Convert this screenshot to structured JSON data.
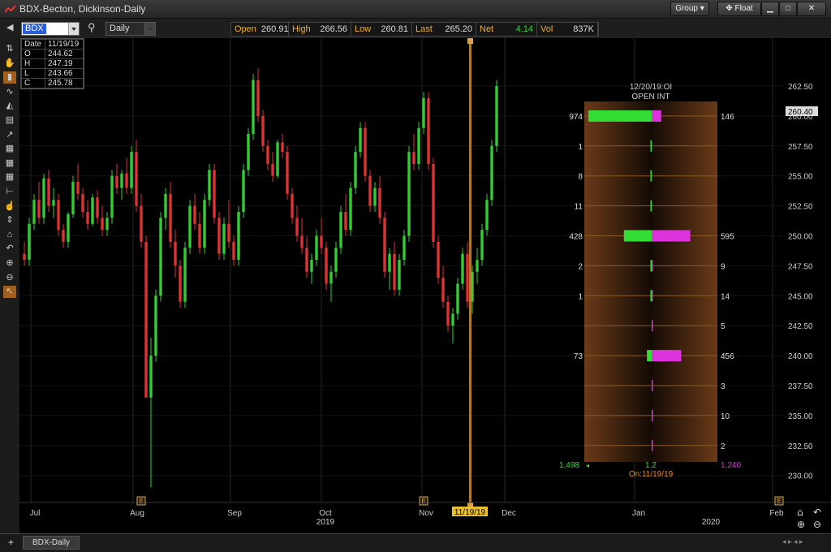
{
  "window": {
    "title": "BDX-Becton, Dickinson-Daily",
    "group_label": "Group",
    "float_label": "Float",
    "min_icon": "minimize-icon",
    "max_icon": "maximize-icon",
    "close_icon": "close-icon"
  },
  "toolbar": {
    "symbol": "BDX",
    "interval": "Daily",
    "quote": [
      {
        "label": "Open",
        "value": "260.91",
        "color": "#dddddd"
      },
      {
        "label": "High",
        "value": "266.56",
        "color": "#dddddd"
      },
      {
        "label": "Low",
        "value": "260.81",
        "color": "#dddddd"
      },
      {
        "label": "Last",
        "value": "265.20",
        "color": "#dddddd"
      },
      {
        "label": "Net",
        "value": "4.14",
        "color": "#33dd33"
      },
      {
        "label": "Vol",
        "value": "837K",
        "color": "#dddddd"
      }
    ]
  },
  "ohlc_box": {
    "rows": [
      {
        "k": "Date",
        "v": "11/19/19"
      },
      {
        "k": "O",
        "v": "244.62"
      },
      {
        "k": "H",
        "v": "247.19"
      },
      {
        "k": "L",
        "v": "243.66"
      },
      {
        "k": "C",
        "v": "245.78"
      }
    ]
  },
  "left_tools": [
    "pan-icon",
    "hand-icon",
    "candles-icon",
    "line-icon",
    "area-icon",
    "bars-icon",
    "kagi-icon",
    "grid-icon",
    "grid2-icon",
    "table-icon",
    "level-icon",
    "pointer-icon",
    "updown-icon",
    "home-icon",
    "undo-icon",
    "zoom-in-icon",
    "zoom-out-icon",
    "cursor-icon"
  ],
  "chart_data": {
    "type": "candlestick",
    "y_ticks": [
      "262.50",
      "260.00",
      "257.50",
      "255.00",
      "252.50",
      "250.00",
      "247.50",
      "245.00",
      "242.50",
      "240.00",
      "237.50",
      "235.00",
      "232.50",
      "230.00"
    ],
    "ylim": [
      229,
      265
    ],
    "last_price": "260.40",
    "x_labels": [
      {
        "text": "Jul",
        "sub": ""
      },
      {
        "text": "Aug",
        "sub": ""
      },
      {
        "text": "Sep",
        "sub": ""
      },
      {
        "text": "Oct",
        "sub": "2019"
      },
      {
        "text": "Nov",
        "sub": ""
      },
      {
        "text": "Dec",
        "sub": ""
      },
      {
        "text": "Jan",
        "sub": ""
      },
      {
        "text": "Feb",
        "sub": "2020"
      }
    ],
    "cursor_date": "11/19/19",
    "earnings_marker": "E",
    "candles": [
      [
        248.5,
        249.5,
        247.5,
        248.0
      ],
      [
        248.0,
        251.5,
        247.5,
        251.0
      ],
      [
        251.0,
        253.5,
        250.5,
        253.0
      ],
      [
        253.0,
        254.5,
        251.0,
        251.5
      ],
      [
        251.5,
        255.2,
        251.0,
        254.8
      ],
      [
        254.8,
        255.5,
        252.0,
        252.5
      ],
      [
        252.5,
        254.0,
        251.5,
        253.0
      ],
      [
        253.0,
        253.5,
        250.0,
        250.5
      ],
      [
        250.5,
        251.0,
        249.0,
        249.5
      ],
      [
        249.5,
        252.0,
        249.0,
        251.8
      ],
      [
        251.8,
        255.0,
        251.5,
        254.5
      ],
      [
        254.5,
        256.0,
        253.0,
        253.5
      ],
      [
        253.5,
        254.0,
        251.5,
        252.0
      ],
      [
        252.0,
        253.0,
        250.5,
        251.0
      ],
      [
        251.0,
        253.5,
        250.8,
        253.2
      ],
      [
        253.2,
        253.8,
        251.0,
        251.5
      ],
      [
        251.5,
        252.5,
        250.0,
        250.5
      ],
      [
        250.5,
        252.0,
        250.0,
        251.5
      ],
      [
        251.5,
        255.5,
        251.0,
        255.0
      ],
      [
        255.0,
        256.0,
        253.5,
        254.0
      ],
      [
        254.0,
        255.5,
        253.0,
        255.2
      ],
      [
        255.2,
        256.5,
        253.5,
        254.0
      ],
      [
        254.0,
        257.5,
        253.5,
        257.0
      ],
      [
        257.0,
        258.0,
        252.0,
        252.5
      ],
      [
        252.5,
        253.5,
        249.0,
        249.5
      ],
      [
        249.5,
        250.0,
        241.0,
        236.5
      ],
      [
        236.5,
        241.5,
        229.0,
        240.0
      ],
      [
        240.0,
        245.5,
        239.5,
        245.0
      ],
      [
        245.0,
        252.0,
        244.5,
        251.5
      ],
      [
        251.5,
        254.0,
        250.5,
        253.5
      ],
      [
        253.5,
        254.5,
        249.0,
        249.5
      ],
      [
        249.5,
        250.5,
        246.5,
        247.5
      ],
      [
        247.5,
        248.0,
        244.0,
        244.5
      ],
      [
        244.5,
        249.5,
        244.0,
        249.0
      ],
      [
        249.0,
        253.0,
        248.5,
        252.5
      ],
      [
        252.5,
        253.5,
        250.5,
        251.0
      ],
      [
        251.0,
        252.0,
        248.5,
        249.0
      ],
      [
        249.0,
        253.5,
        248.5,
        253.0
      ],
      [
        253.0,
        256.0,
        252.5,
        255.5
      ],
      [
        255.5,
        256.0,
        251.0,
        251.5
      ],
      [
        251.5,
        252.0,
        248.0,
        248.5
      ],
      [
        248.5,
        251.5,
        248.0,
        251.0
      ],
      [
        251.0,
        253.0,
        249.0,
        249.5
      ],
      [
        249.5,
        250.0,
        247.5,
        248.0
      ],
      [
        248.0,
        252.5,
        247.5,
        252.0
      ],
      [
        252.0,
        256.0,
        251.5,
        255.5
      ],
      [
        255.5,
        259.0,
        255.0,
        258.5
      ],
      [
        258.5,
        263.5,
        258.0,
        263.0
      ],
      [
        263.0,
        264.0,
        259.5,
        260.0
      ],
      [
        260.0,
        260.5,
        257.0,
        257.5
      ],
      [
        257.5,
        258.0,
        255.5,
        256.0
      ],
      [
        256.0,
        257.0,
        254.5,
        255.0
      ],
      [
        255.0,
        258.0,
        254.8,
        257.8
      ],
      [
        257.8,
        258.5,
        256.5,
        257.0
      ],
      [
        257.0,
        257.5,
        253.0,
        253.5
      ],
      [
        253.5,
        254.0,
        251.0,
        251.5
      ],
      [
        251.5,
        252.5,
        249.5,
        250.0
      ],
      [
        250.0,
        251.5,
        248.5,
        249.0
      ],
      [
        249.0,
        250.0,
        246.5,
        247.0
      ],
      [
        247.0,
        248.5,
        246.0,
        248.0
      ],
      [
        248.0,
        250.5,
        247.5,
        250.0
      ],
      [
        250.0,
        251.5,
        248.5,
        249.0
      ],
      [
        249.0,
        249.5,
        245.5,
        246.0
      ],
      [
        246.0,
        247.5,
        244.5,
        247.0
      ],
      [
        247.0,
        249.5,
        246.5,
        249.0
      ],
      [
        249.0,
        252.5,
        248.5,
        252.0
      ],
      [
        252.0,
        253.5,
        250.0,
        250.5
      ],
      [
        250.5,
        254.5,
        250.0,
        254.0
      ],
      [
        254.0,
        257.5,
        253.5,
        257.0
      ],
      [
        257.0,
        259.5,
        256.5,
        259.0
      ],
      [
        259.0,
        259.5,
        254.5,
        255.0
      ],
      [
        255.0,
        255.5,
        252.0,
        252.5
      ],
      [
        252.5,
        254.5,
        252.0,
        254.0
      ],
      [
        254.0,
        255.0,
        251.0,
        251.5
      ],
      [
        251.5,
        252.0,
        246.5,
        247.0
      ],
      [
        247.0,
        249.0,
        245.5,
        248.5
      ],
      [
        248.5,
        249.5,
        245.0,
        245.5
      ],
      [
        245.5,
        248.5,
        245.0,
        248.0
      ],
      [
        248.0,
        250.5,
        247.5,
        250.0
      ],
      [
        250.0,
        257.5,
        249.5,
        257.0
      ],
      [
        257.0,
        258.5,
        255.5,
        256.0
      ],
      [
        256.0,
        259.5,
        255.5,
        259.0
      ],
      [
        259.0,
        262.0,
        258.5,
        261.5
      ],
      [
        261.5,
        262.0,
        255.5,
        256.0
      ],
      [
        256.0,
        256.5,
        249.0,
        249.5
      ],
      [
        249.5,
        250.0,
        246.0,
        246.5
      ],
      [
        246.5,
        247.5,
        244.0,
        244.5
      ],
      [
        244.5,
        245.0,
        242.0,
        242.5
      ],
      [
        242.5,
        244.0,
        241.0,
        243.5
      ],
      [
        243.5,
        246.5,
        243.0,
        246.0
      ],
      [
        246.0,
        249.0,
        245.5,
        248.5
      ],
      [
        248.5,
        249.5,
        244.0,
        244.5
      ],
      [
        244.5,
        247.5,
        243.5,
        247.0
      ],
      [
        247.0,
        249.0,
        246.0,
        248.0
      ],
      [
        248.0,
        251.0,
        247.5,
        250.5
      ],
      [
        250.5,
        253.5,
        250.0,
        253.0
      ],
      [
        253.0,
        258.0,
        252.5,
        257.5
      ],
      [
        257.5,
        263.0,
        257.0,
        262.5
      ]
    ]
  },
  "oi_panel": {
    "header_line1": "12/20/19:OI",
    "header_line2": "OPEN INT",
    "rows": [
      {
        "price": 260.0,
        "left": "974",
        "right": "146",
        "call": 974,
        "put": 146
      },
      {
        "price": 257.5,
        "left": "1",
        "right": "",
        "call": 1,
        "put": 0
      },
      {
        "price": 255.0,
        "left": "8",
        "right": "",
        "call": 8,
        "put": 0
      },
      {
        "price": 252.5,
        "left": "11",
        "right": "",
        "call": 11,
        "put": 0
      },
      {
        "price": 250.0,
        "left": "428",
        "right": "595",
        "call": 428,
        "put": 595
      },
      {
        "price": 247.5,
        "left": "2",
        "right": "9",
        "call": 2,
        "put": 9
      },
      {
        "price": 245.0,
        "left": "1",
        "right": "14",
        "call": 1,
        "put": 14
      },
      {
        "price": 242.5,
        "left": "",
        "right": "5",
        "call": 0,
        "put": 5
      },
      {
        "price": 240.0,
        "left": "73",
        "right": "456",
        "call": 73,
        "put": 456
      },
      {
        "price": 237.5,
        "left": "",
        "right": "3",
        "call": 0,
        "put": 3
      },
      {
        "price": 235.0,
        "left": "",
        "right": "10",
        "call": 0,
        "put": 10
      },
      {
        "price": 232.5,
        "left": "",
        "right": "2",
        "call": 0,
        "put": 2
      }
    ],
    "total_calls": "1,498",
    "ratio": "1.2",
    "total_puts": "1,240",
    "as_of": "On:11/19/19",
    "call_color": "#33dd33",
    "put_color": "#dd33dd"
  },
  "bottom": {
    "tab_label": "BDX-Daily",
    "add_icon": "plus-icon"
  }
}
